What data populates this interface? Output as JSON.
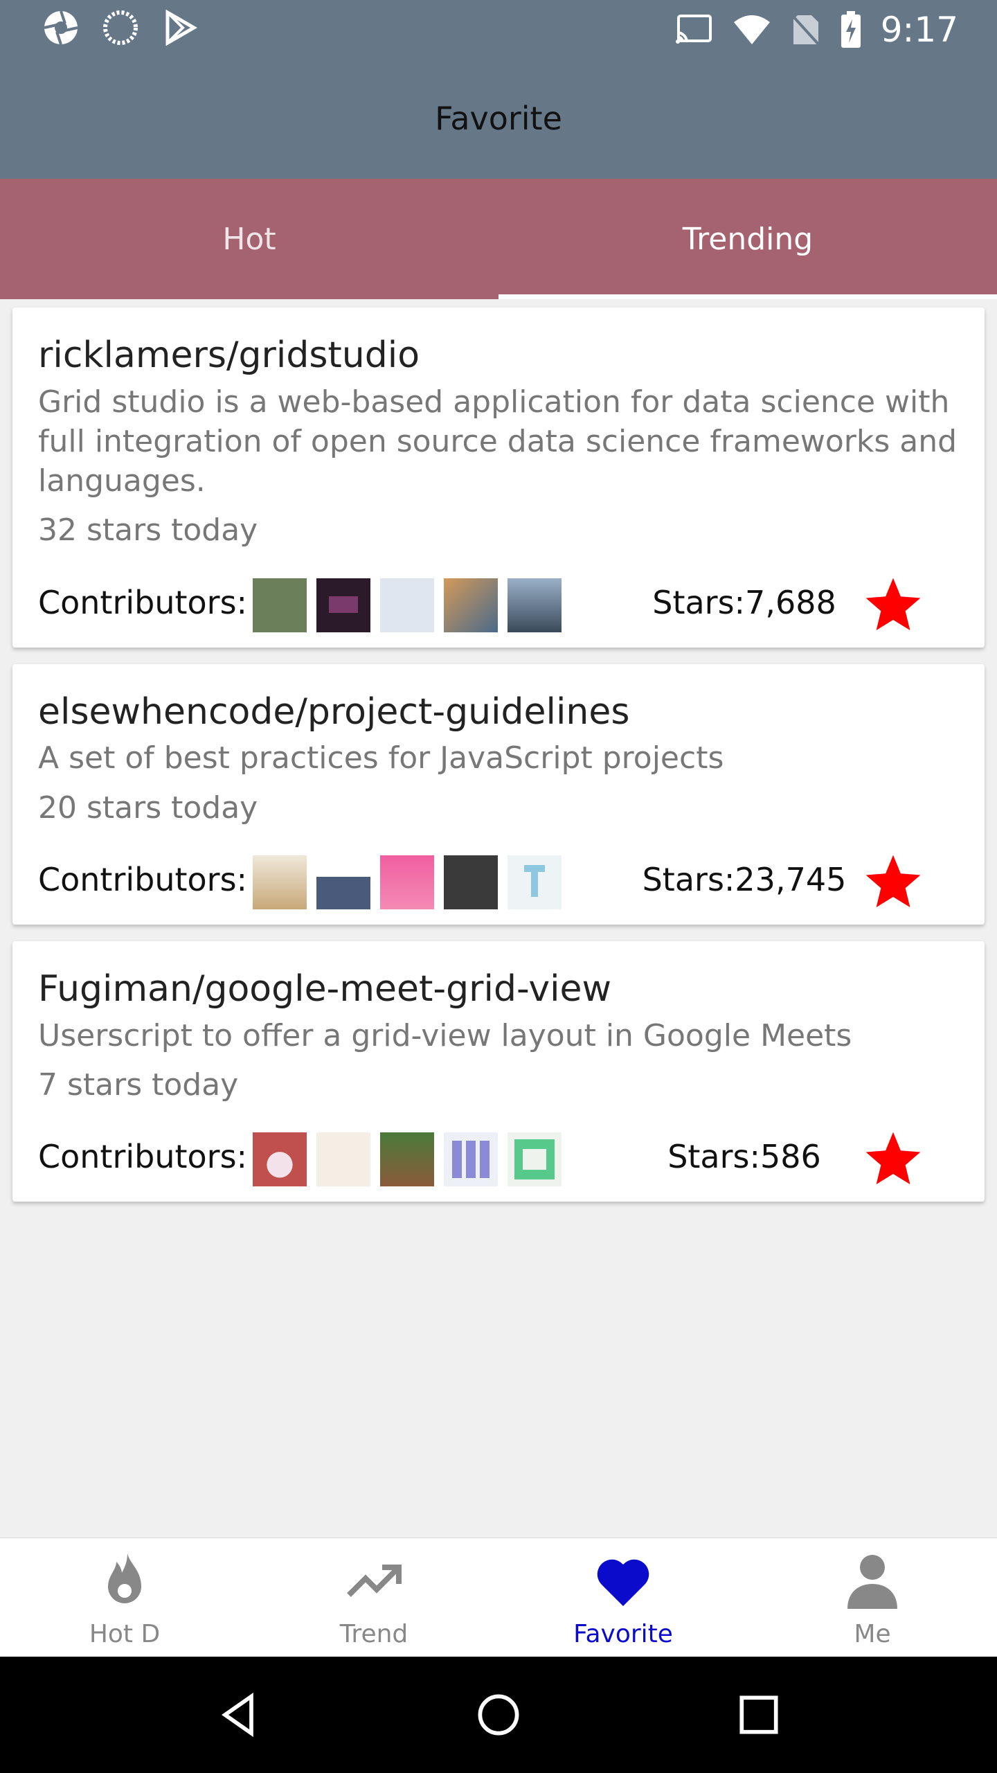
{
  "status_bar": {
    "time": "9:17",
    "left_icons": [
      "aperture-icon",
      "sync-icon",
      "play-store-icon"
    ],
    "right_icons": [
      "cast-icon",
      "wifi-icon",
      "no-sim-icon",
      "battery-charging-icon"
    ]
  },
  "header": {
    "title": "Favorite"
  },
  "tabs": [
    {
      "label": "Hot",
      "active": false
    },
    {
      "label": "Trending",
      "active": true
    }
  ],
  "repos": [
    {
      "name": "ricklamers/gridstudio",
      "description": "Grid studio is a web-based application for data science with full integration of open source data science frameworks and languages.",
      "today": "32 stars today",
      "contributors_label": "Contributors:",
      "avatars": [
        "#6b7f5a",
        "#2a1a2a",
        "#dfe6ef",
        "#b88a5a",
        "#7a95b0"
      ],
      "stars": "Stars:7,688",
      "favorited": true
    },
    {
      "name": "elsewhencode/project-guidelines",
      "description": "A set of best practices for JavaScript projects",
      "today": "20 stars today",
      "contributors_label": "Contributors:",
      "avatars": [
        "#d9c9b3",
        "#4a5a7a",
        "#f06aa0",
        "#3a3a3a",
        "#cfe6ef"
      ],
      "stars": "Stars:23,745",
      "favorited": true
    },
    {
      "name": "Fugiman/google-meet-grid-view",
      "description": "Userscript to offer a grid-view layout in Google Meets",
      "today": "7 stars today",
      "contributors_label": "Contributors:",
      "avatars": [
        "#c0504d",
        "#e0d8cc",
        "#6a6a3a",
        "#8a8ad6",
        "#57c98a"
      ],
      "stars": "Stars:586",
      "favorited": true
    }
  ],
  "bottom_nav": [
    {
      "label": "Hot D",
      "icon": "flame-icon",
      "active": false
    },
    {
      "label": "Trend",
      "icon": "trending-up-icon",
      "active": false
    },
    {
      "label": "Favorite",
      "icon": "heart-icon",
      "active": true
    },
    {
      "label": "Me",
      "icon": "person-icon",
      "active": false
    }
  ],
  "colors": {
    "header": "#667788",
    "tab_bar": "#a56370",
    "favorite_star": "#ff0000",
    "active_nav": "#0b0bcc",
    "inactive_nav": "#888888"
  }
}
